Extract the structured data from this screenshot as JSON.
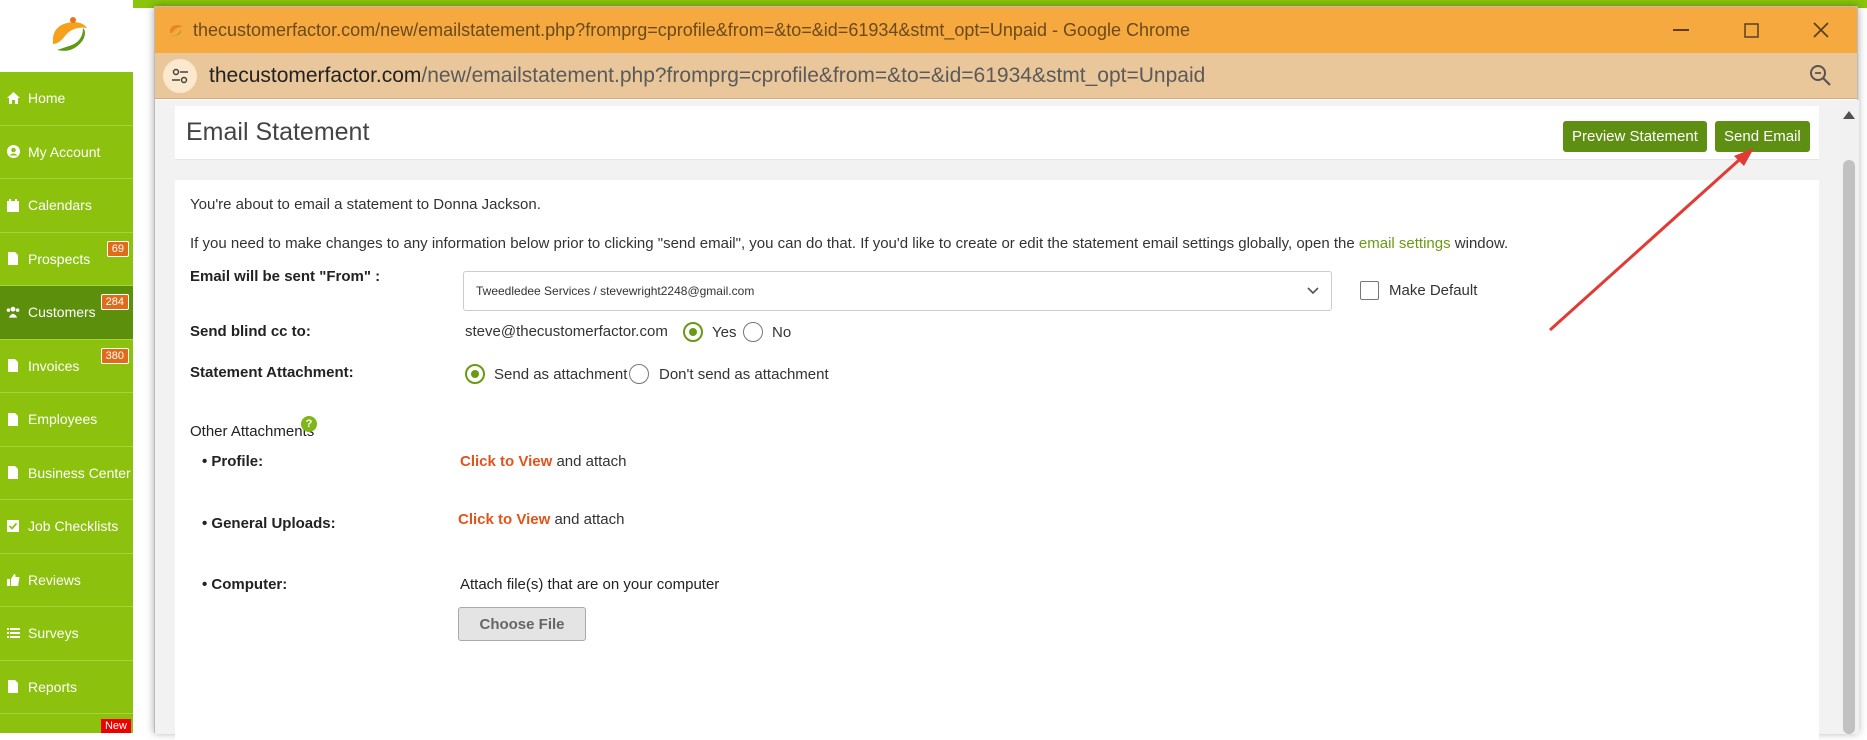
{
  "window": {
    "title": "thecustomerfactor.com/new/emailstatement.php?fromprg=cprofile&from=&to=&id=61934&stmt_opt=Unpaid - Google Chrome",
    "url_host": "thecustomerfactor.com",
    "url_path": "/new/emailstatement.php?fromprg=cprofile&from=&to=&id=61934&stmt_opt=Unpaid"
  },
  "sidebar": {
    "items": [
      {
        "label": "Home",
        "icon": "home-icon"
      },
      {
        "label": "My Account",
        "icon": "user-circle-icon"
      },
      {
        "label": "Calendars",
        "icon": "calendar-icon"
      },
      {
        "label": "Prospects",
        "icon": "document-icon",
        "badge": "69"
      },
      {
        "label": "Customers",
        "icon": "users-icon",
        "badge": "284",
        "active": true
      },
      {
        "label": "Invoices",
        "icon": "document-icon",
        "badge": "380"
      },
      {
        "label": "Employees",
        "icon": "document-icon"
      },
      {
        "label": "Business Center",
        "icon": "document-icon"
      },
      {
        "label": "Job Checklists",
        "icon": "checkbox-icon"
      },
      {
        "label": "Reviews",
        "icon": "thumbs-up-icon"
      },
      {
        "label": "Surveys",
        "icon": "list-icon"
      },
      {
        "label": "Reports",
        "icon": "document-icon"
      }
    ],
    "new_tag": "New"
  },
  "page": {
    "title": "Email Statement",
    "preview_button": "Preview Statement",
    "send_button": "Send Email",
    "intro": "You're about to email a statement to Donna Jackson.",
    "note_before": "If you need to make changes to any information below prior to clicking \"send email\", you can do that. If you'd like to create or edit the statement email settings globally, open the",
    "note_link": "email settings",
    "note_after": "window.",
    "from_label": "Email will be sent \"From\" :",
    "from_value": "Tweedledee Services / stevewright2248@gmail.com",
    "make_default": "Make Default",
    "bcc_label": "Send blind cc to:",
    "bcc_email": "steve@thecustomerfactor.com",
    "bcc_yes": "Yes",
    "bcc_no": "No",
    "attach_label": "Statement Attachment:",
    "attach_yes": "Send as attachment",
    "attach_no": "Don't send as attachment",
    "other_label": "Other Attachments",
    "profile_label": "• Profile:",
    "uploads_label": "• General Uploads:",
    "computer_label": "• Computer:",
    "click_to_view": "Click to View",
    "and_attach": "and attach",
    "computer_text": "Attach file(s) that are on your computer",
    "choose_file": "Choose File"
  },
  "colors": {
    "sidebar": "#8cc20e",
    "accent": "#5e8f12",
    "titlebar": "#f6a93e",
    "link": "#e2541b"
  }
}
